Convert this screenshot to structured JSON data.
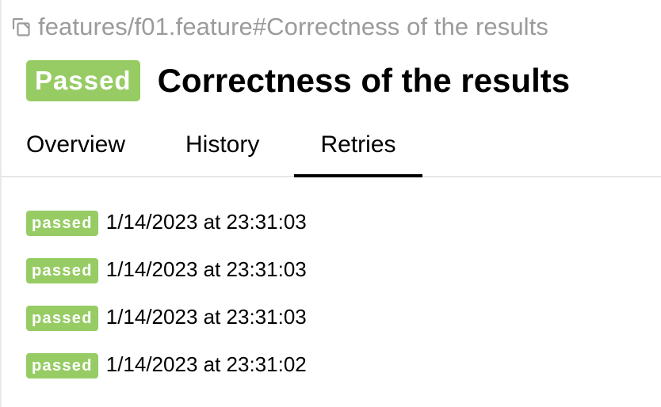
{
  "breadcrumb": {
    "icon": "copy-icon",
    "path": "features/f01.feature#Correctness of the results"
  },
  "header": {
    "status": "Passed",
    "title": "Correctness of the results"
  },
  "tabs": [
    {
      "label": "Overview",
      "active": false
    },
    {
      "label": "History",
      "active": false
    },
    {
      "label": "Retries",
      "active": true
    }
  ],
  "retries": [
    {
      "status": "passed",
      "time": "1/14/2023 at 23:31:03"
    },
    {
      "status": "passed",
      "time": "1/14/2023 at 23:31:03"
    },
    {
      "status": "passed",
      "time": "1/14/2023 at 23:31:03"
    },
    {
      "status": "passed",
      "time": "1/14/2023 at 23:31:02"
    }
  ],
  "colors": {
    "passed": "#97cc64",
    "muted_text": "#9b9b9b",
    "active_tab_underline": "#000000"
  }
}
